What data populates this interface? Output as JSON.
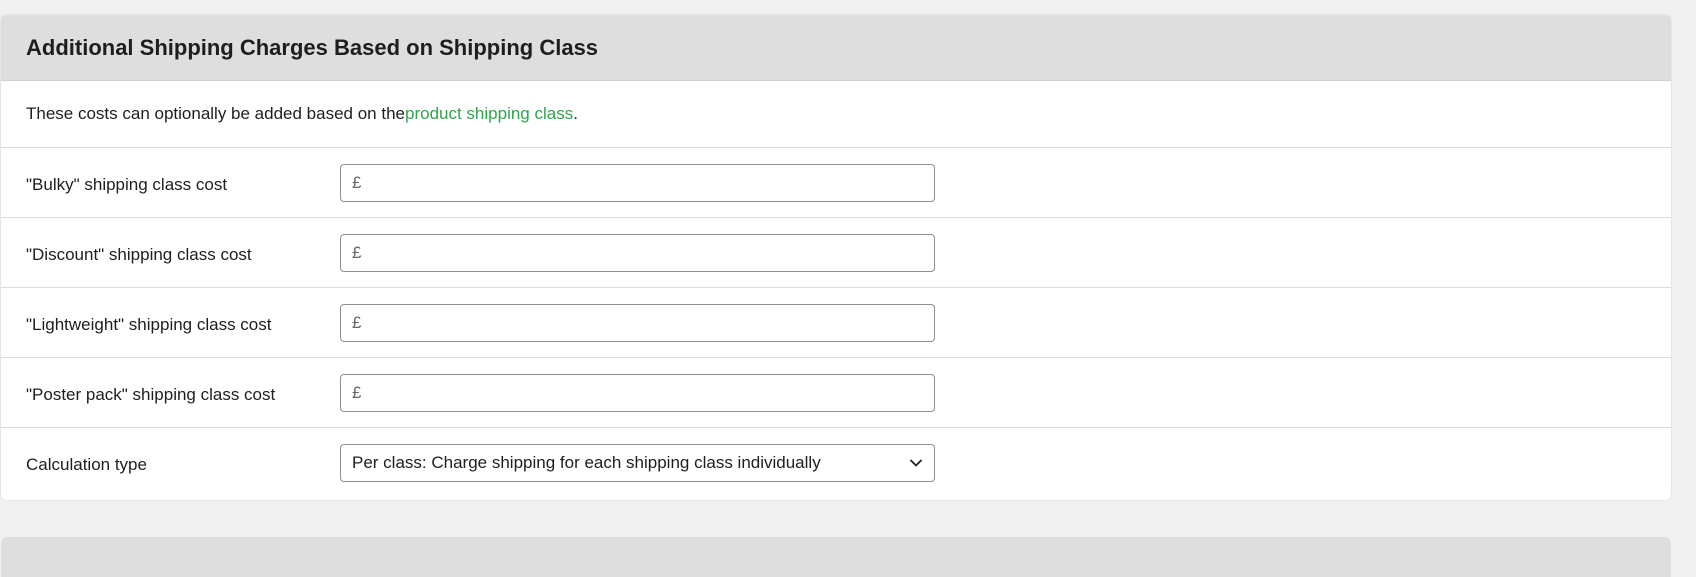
{
  "section": {
    "title": "Additional Shipping Charges Based on Shipping Class",
    "description_prefix": "These costs can optionally be added based on the ",
    "description_link": "product shipping class",
    "description_suffix": "."
  },
  "class_costs": [
    {
      "label": "\"Bulky\" shipping class cost",
      "currency": "£",
      "value": ""
    },
    {
      "label": "\"Discount\" shipping class cost",
      "currency": "£",
      "value": ""
    },
    {
      "label": "\"Lightweight\" shipping class cost",
      "currency": "£",
      "value": ""
    },
    {
      "label": "\"Poster pack\" shipping class cost",
      "currency": "£",
      "value": ""
    }
  ],
  "calculation": {
    "label": "Calculation type",
    "selected": "Per class: Charge shipping for each shipping class individually",
    "icon": "chevron-down-icon"
  },
  "colors": {
    "link": "#2fa54b",
    "header_bg": "#dedede",
    "page_bg": "#f0f0f0"
  }
}
